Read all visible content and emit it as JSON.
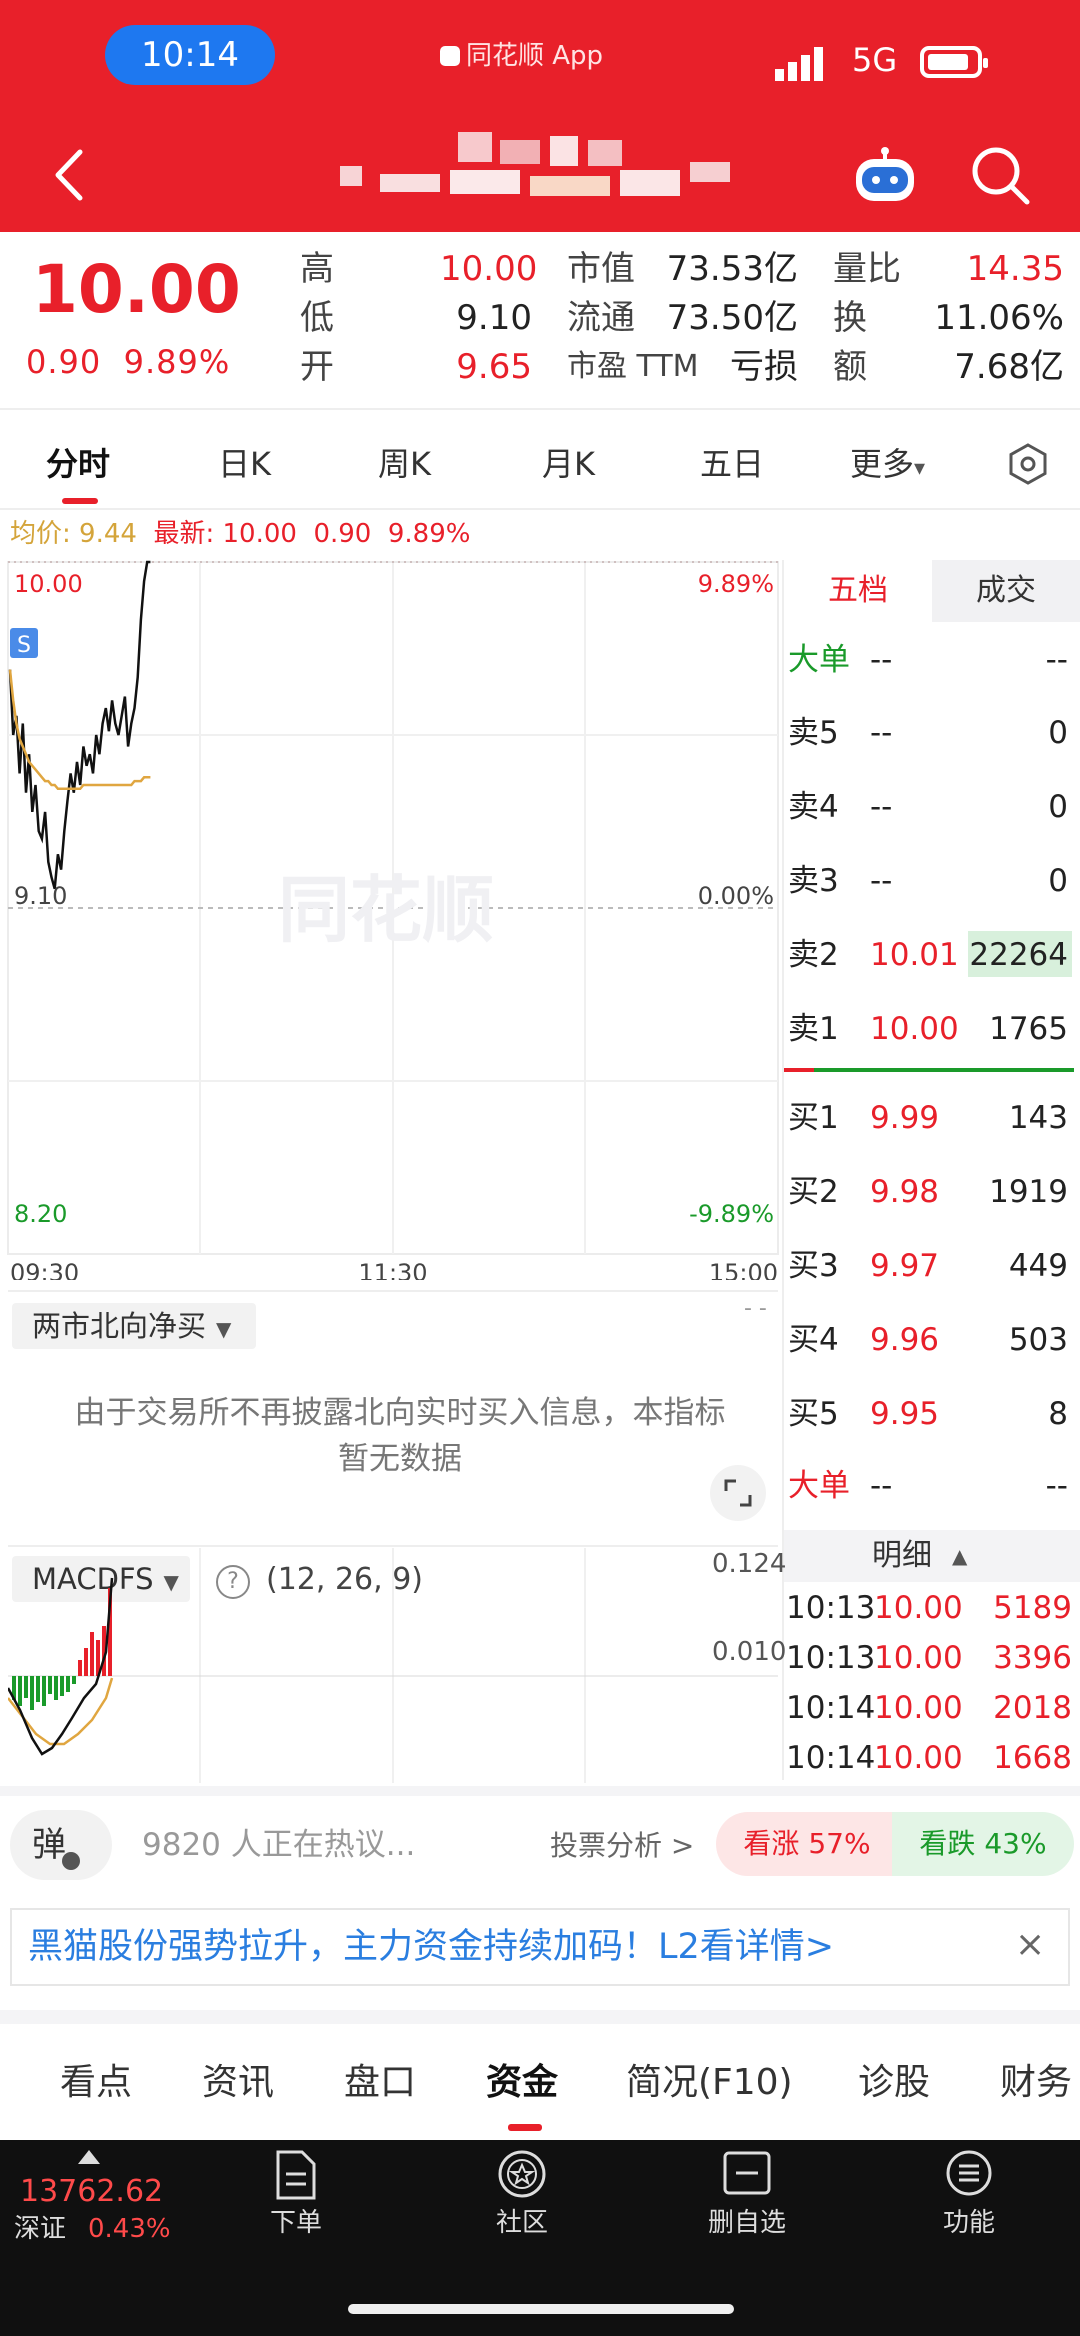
{
  "status_bar": {
    "time": "10:14",
    "source_app": "同花顺 App",
    "network": "5G"
  },
  "header": {
    "title_obscured": true
  },
  "quote": {
    "price": "10.00",
    "change": "0.90",
    "change_pct": "9.89%",
    "fields": [
      {
        "label": "高",
        "value": "10.00",
        "color": "red"
      },
      {
        "label": "低",
        "value": "9.10",
        "color": "default"
      },
      {
        "label": "开",
        "value": "9.65",
        "color": "red"
      },
      {
        "label": "市值",
        "value": "73.53亿",
        "color": "default"
      },
      {
        "label": "流通",
        "value": "73.50亿",
        "color": "default"
      },
      {
        "label": "市盈 TTM",
        "value": "亏损",
        "color": "default"
      },
      {
        "label": "量比",
        "value": "14.35",
        "color": "red"
      },
      {
        "label": "换",
        "value": "11.06%",
        "color": "default"
      },
      {
        "label": "额",
        "value": "7.68亿",
        "color": "default"
      }
    ]
  },
  "chart_tabs": {
    "items": [
      "分时",
      "日K",
      "周K",
      "月K",
      "五日",
      "更多"
    ],
    "active": "分时",
    "more_caret": "▾"
  },
  "intraday": {
    "info": {
      "avg_label": "均价:",
      "avg": "9.44",
      "latest_label": "最新:",
      "latest": "10.00",
      "chg": "0.90",
      "pct": "9.89%"
    },
    "price_axis": {
      "high": "10.00",
      "mid": "9.10",
      "low": "8.20"
    },
    "pct_axis": {
      "high": "9.89%",
      "mid": "0.00%",
      "low": "-9.89%"
    },
    "time_axis": [
      "09:30",
      "11:30",
      "15:00"
    ],
    "marker": "S",
    "watermark": "同花顺"
  },
  "chart_data": [
    {
      "type": "line",
      "title": "",
      "xlabel": "",
      "ylabel": "",
      "x": [
        "09:30",
        "09:31",
        "09:32",
        "09:33",
        "09:34",
        "09:35",
        "09:36",
        "09:37",
        "09:38",
        "09:39",
        "09:40",
        "09:41",
        "09:42",
        "09:43",
        "09:44",
        "09:45",
        "09:46",
        "09:47",
        "09:48",
        "09:49",
        "09:50",
        "09:51",
        "09:52",
        "09:53",
        "09:54",
        "09:55",
        "09:56",
        "09:57",
        "09:58",
        "09:59",
        "10:00",
        "10:01",
        "10:02",
        "10:03",
        "10:04",
        "10:05",
        "10:06",
        "10:07",
        "10:08",
        "10:09",
        "10:10",
        "10:11",
        "10:12",
        "10:13",
        "10:14"
      ],
      "xlim": [
        "09:30",
        "15:00"
      ],
      "ylim": [
        8.2,
        10.0
      ],
      "series": [
        {
          "values": [
            9.72,
            9.55,
            9.6,
            9.45,
            9.58,
            9.4,
            9.5,
            9.35,
            9.42,
            9.3,
            9.28,
            9.35,
            9.22,
            9.18,
            9.15,
            9.24,
            9.2,
            9.3,
            9.38,
            9.45,
            9.4,
            9.48,
            9.42,
            9.52,
            9.47,
            9.5,
            9.45,
            9.55,
            9.5,
            9.58,
            9.62,
            9.56,
            9.64,
            9.58,
            9.55,
            9.6,
            9.65,
            9.52,
            9.58,
            9.62,
            9.7,
            9.85,
            9.95,
            10.0,
            10.0
          ],
          "color": "#111111"
        },
        {
          "values": [
            9.72,
            9.64,
            9.58,
            9.54,
            9.52,
            9.5,
            9.48,
            9.47,
            9.46,
            9.45,
            9.44,
            9.43,
            9.43,
            9.42,
            9.42,
            9.41,
            9.41,
            9.41,
            9.41,
            9.41,
            9.41,
            9.41,
            9.41,
            9.42,
            9.42,
            9.42,
            9.42,
            9.42,
            9.42,
            9.42,
            9.42,
            9.42,
            9.42,
            9.42,
            9.42,
            9.42,
            9.42,
            9.42,
            9.42,
            9.43,
            9.43,
            9.43,
            9.44,
            9.44,
            9.44
          ],
          "color": "#e0a640"
        }
      ]
    }
  ],
  "order_book": {
    "tabs": [
      "五档",
      "成交"
    ],
    "big_order_label": "大单",
    "big_order_price": "--",
    "big_order_vol": "--",
    "asks": [
      {
        "label": "卖5",
        "price": "--",
        "vol": "0"
      },
      {
        "label": "卖4",
        "price": "--",
        "vol": "0"
      },
      {
        "label": "卖3",
        "price": "--",
        "vol": "0"
      },
      {
        "label": "卖2",
        "price": "10.01",
        "vol": "22264"
      },
      {
        "label": "卖1",
        "price": "10.00",
        "vol": "1765"
      }
    ],
    "bids": [
      {
        "label": "买1",
        "price": "9.99",
        "vol": "143"
      },
      {
        "label": "买2",
        "price": "9.98",
        "vol": "1919"
      },
      {
        "label": "买3",
        "price": "9.97",
        "vol": "449"
      },
      {
        "label": "买4",
        "price": "9.96",
        "vol": "503"
      },
      {
        "label": "买5",
        "price": "9.95",
        "vol": "8"
      }
    ],
    "big_order_label_2": "大单",
    "detail_header": "明细",
    "detail_caret": "▲",
    "trades": [
      {
        "time": "10:13",
        "price": "10.00",
        "vol": "5189"
      },
      {
        "time": "10:13",
        "price": "10.00",
        "vol": "3396"
      },
      {
        "time": "10:14",
        "price": "10.00",
        "vol": "2018"
      },
      {
        "time": "10:14",
        "price": "10.00",
        "vol": "1668"
      }
    ]
  },
  "northbound": {
    "selector": "两市北向净买",
    "message_line1": "由于交易所不再披露北向实时买入信息，本指标",
    "message_line2": "暂无数据",
    "dashes": "- -"
  },
  "macd": {
    "selector": "MACDFS",
    "help_icon": "?",
    "params": "(12, 26, 9)",
    "axis_top": "0.124",
    "axis_mid": "0.010"
  },
  "discussion": {
    "dan_label": "弹",
    "text": "9820 人正在热议...",
    "vote_link": "投票分析 >",
    "bull": "看涨 57%",
    "bear": "看跌 43%"
  },
  "banner": {
    "text": "黑猫股份强势拉升，主力资金持续加码！L2看详情>",
    "close": "×"
  },
  "bottom_tabs": {
    "items": [
      "看点",
      "资讯",
      "盘口",
      "资金",
      "简况(F10)",
      "诊股",
      "财务"
    ],
    "active": "资金"
  },
  "nav": {
    "index_value": "13762.62",
    "index_name": "深证",
    "index_pct": "0.43%",
    "items": [
      "下单",
      "社区",
      "删自选",
      "功能"
    ]
  },
  "colors": {
    "brand_red": "#e8202a",
    "down_green": "#1a9a2a",
    "link_blue": "#2a7ee0",
    "avg_line": "#e0a640"
  }
}
